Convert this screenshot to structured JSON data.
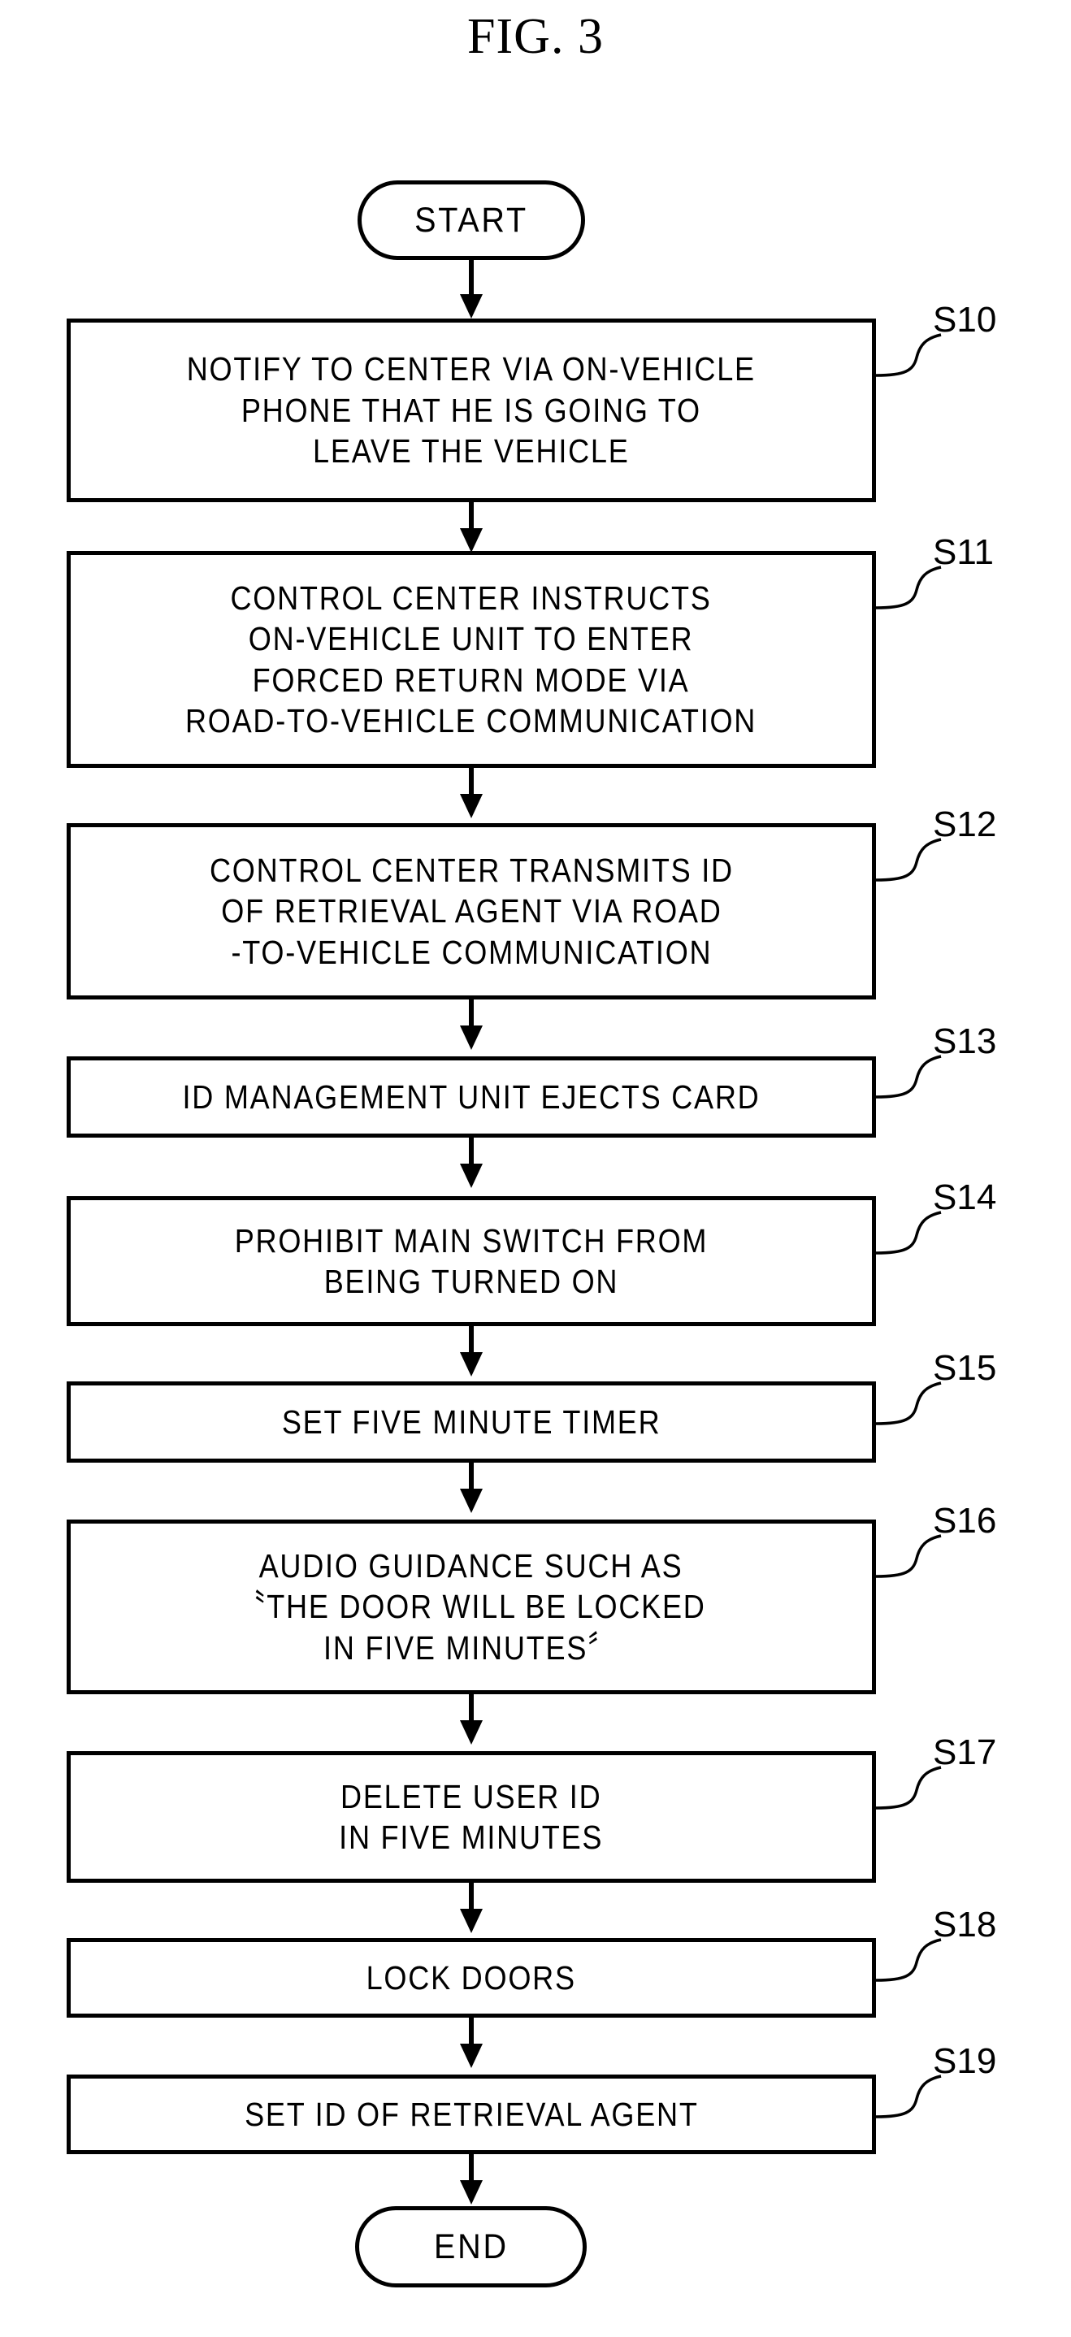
{
  "figure": {
    "title": "FIG. 3",
    "type": "patent-flowchart"
  },
  "flowchart": {
    "start_terminator": {
      "label": "START",
      "shape": "rounded-oval"
    },
    "end_terminator": {
      "label": "END",
      "shape": "rounded-oval"
    },
    "steps": [
      {
        "id": "S10",
        "label": "S10",
        "text": "NOTIFY TO CENTER VIA ON-VEHICLE\nPHONE THAT HE IS GOING TO\nLEAVE THE VEHICLE",
        "lines": 3
      },
      {
        "id": "S11",
        "label": "S11",
        "text": "CONTROL CENTER INSTRUCTS\nON-VEHICLE UNIT TO ENTER\nFORCED RETURN MODE VIA\nROAD-TO-VEHICLE COMMUNICATION",
        "lines": 4
      },
      {
        "id": "S12",
        "label": "S12",
        "text": "CONTROL CENTER TRANSMITS ID\nOF RETRIEVAL AGENT VIA ROAD\n-TO-VEHICLE COMMUNICATION",
        "lines": 3
      },
      {
        "id": "S13",
        "label": "S13",
        "text": "ID MANAGEMENT UNIT EJECTS CARD",
        "lines": 1
      },
      {
        "id": "S14",
        "label": "S14",
        "text": "PROHIBIT MAIN SWITCH FROM\nBEING TURNED ON",
        "lines": 2
      },
      {
        "id": "S15",
        "label": "S15",
        "text": "SET FIVE MINUTE TIMER",
        "lines": 1
      },
      {
        "id": "S16",
        "label": "S16",
        "text": "AUDIO GUIDANCE SUCH AS\n〝THE DOOR WILL BE LOCKED\nIN FIVE MINUTES〞",
        "lines": 3
      },
      {
        "id": "S17",
        "label": "S17",
        "text": "DELETE USER ID\nIN FIVE MINUTES",
        "lines": 2
      },
      {
        "id": "S18",
        "label": "S18",
        "text": "LOCK DOORS",
        "lines": 1
      },
      {
        "id": "S19",
        "label": "S19",
        "text": "SET ID OF RETRIEVAL AGENT",
        "lines": 1
      }
    ]
  },
  "style": {
    "ink_color": "#000000",
    "paper_color": "#ffffff"
  }
}
